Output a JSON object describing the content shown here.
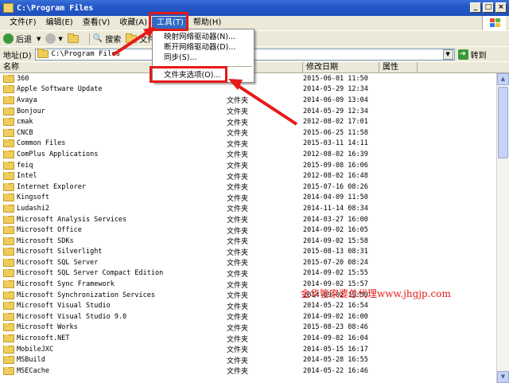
{
  "window": {
    "title": "C:\\Program Files"
  },
  "menu": {
    "items": [
      {
        "label": "文件(F)",
        "active": false
      },
      {
        "label": "编辑(E)",
        "active": false
      },
      {
        "label": "查看(V)",
        "active": false
      },
      {
        "label": "收藏(A)",
        "active": false
      },
      {
        "label": "工具(T)",
        "active": true
      },
      {
        "label": "帮助(H)",
        "active": false
      }
    ]
  },
  "toolbar": {
    "back_label": "后退",
    "search_label": "搜索",
    "folders_label": "文件"
  },
  "address": {
    "label": "地址(D)",
    "value": "C:\\Program Files",
    "go_label": "转到"
  },
  "columns": {
    "name": "名称",
    "date": "修改日期",
    "attr": "属性"
  },
  "dropdown": {
    "items": [
      {
        "label": "映射网络驱动器(N)..."
      },
      {
        "label": "断开网络驱动器(D)..."
      },
      {
        "label": "同步(S)..."
      }
    ],
    "folder_options": "文件夹选项(O)..."
  },
  "rows": [
    {
      "name": "360",
      "type": "",
      "date": "2015-06-01 11:50"
    },
    {
      "name": "Apple Software Update",
      "type": "",
      "date": "2014-05-29 12:34"
    },
    {
      "name": "Avaya",
      "type": "文件夹",
      "date": "2014-06-09 13:04"
    },
    {
      "name": "Bonjour",
      "type": "文件夹",
      "date": "2014-05-29 12:34"
    },
    {
      "name": "cmak",
      "type": "文件夹",
      "date": "2012-08-02 17:01"
    },
    {
      "name": "CNCB",
      "type": "文件夹",
      "date": "2015-06-25 11:58"
    },
    {
      "name": "Common Files",
      "type": "文件夹",
      "date": "2015-03-11 14:11"
    },
    {
      "name": "ComPlus Applications",
      "type": "文件夹",
      "date": "2012-08-02 16:39"
    },
    {
      "name": "feiq",
      "type": "文件夹",
      "date": "2015-09-08 16:06"
    },
    {
      "name": "Intel",
      "type": "文件夹",
      "date": "2012-08-02 16:48"
    },
    {
      "name": "Internet Explorer",
      "type": "文件夹",
      "date": "2015-07-16 08:26"
    },
    {
      "name": "Kingsoft",
      "type": "文件夹",
      "date": "2014-04-09 11:50"
    },
    {
      "name": "Ludashi2",
      "type": "文件夹",
      "date": "2014-11-14 08:34"
    },
    {
      "name": "Microsoft Analysis Services",
      "type": "文件夹",
      "date": "2014-03-27 16:00"
    },
    {
      "name": "Microsoft Office",
      "type": "文件夹",
      "date": "2014-09-02 16:05"
    },
    {
      "name": "Microsoft SDKs",
      "type": "文件夹",
      "date": "2014-09-02 15:58"
    },
    {
      "name": "Microsoft Silverlight",
      "type": "文件夹",
      "date": "2015-08-13 08:31"
    },
    {
      "name": "Microsoft SQL Server",
      "type": "文件夹",
      "date": "2015-07-20 08:24"
    },
    {
      "name": "Microsoft SQL Server Compact Edition",
      "type": "文件夹",
      "date": "2014-09-02 15:55"
    },
    {
      "name": "Microsoft Sync Framework",
      "type": "文件夹",
      "date": "2014-09-02 15:57"
    },
    {
      "name": "Microsoft Synchronization Services",
      "type": "文件夹",
      "date": "2014-09-02 15:59"
    },
    {
      "name": "Microsoft Visual Studio",
      "type": "文件夹",
      "date": "2014-05-22 16:54"
    },
    {
      "name": "Microsoft Visual Studio 9.0",
      "type": "文件夹",
      "date": "2014-09-02 16:00"
    },
    {
      "name": "Microsoft Works",
      "type": "文件夹",
      "date": "2015-08-23 08:46"
    },
    {
      "name": "Microsoft.NET",
      "type": "文件夹",
      "date": "2014-09-02 16:04"
    },
    {
      "name": "MobileJXC",
      "type": "文件夹",
      "date": "2014-05-15 16:17"
    },
    {
      "name": "MSBuild",
      "type": "文件夹",
      "date": "2014-05-28 16:55"
    },
    {
      "name": "MSECache",
      "type": "文件夹",
      "date": "2014-05-22 16:46"
    }
  ],
  "watermark": "金华管家婆总代理www.jhgjp.com",
  "colors": {
    "highlight": "#e51a1a",
    "titlebar": "#2458c8",
    "chrome": "#ece9d8"
  }
}
